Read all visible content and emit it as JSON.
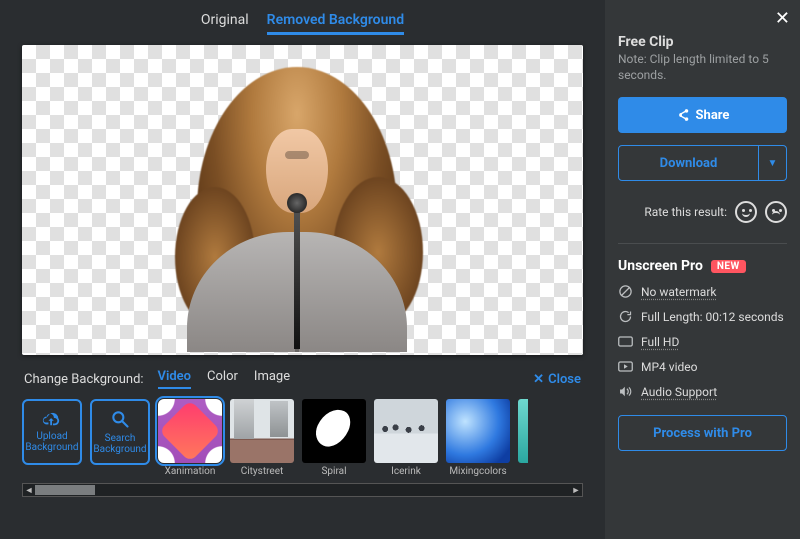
{
  "tabs": {
    "original": "Original",
    "removed": "Removed Background"
  },
  "bg": {
    "label": "Change Background:",
    "video": "Video",
    "color": "Color",
    "image": "Image",
    "close": "Close",
    "upload": "Upload Background",
    "search": "Search Background",
    "thumbs": [
      "Xanimation",
      "Citystreet",
      "Spiral",
      "Icerink",
      "Mixingcolors"
    ]
  },
  "sidebar": {
    "title": "Free Clip",
    "note": "Note: Clip length limited to 5 seconds.",
    "share": "Share",
    "download": "Download",
    "rate": "Rate this result:",
    "pro_title": "Unscreen Pro",
    "new": "NEW",
    "feat_nowm": "No watermark",
    "feat_len": "Full Length: 00:12 seconds",
    "feat_hd": "Full HD",
    "feat_mp4": "MP4 video",
    "feat_audio": "Audio Support",
    "process": "Process with Pro"
  }
}
